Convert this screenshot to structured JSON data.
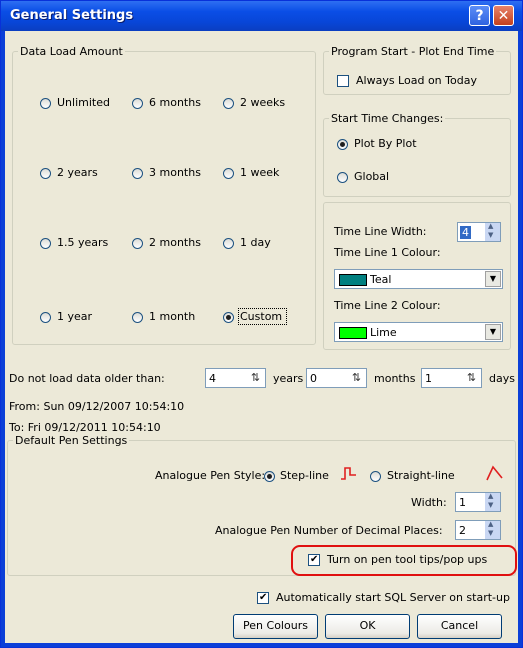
{
  "window": {
    "title": "General Settings",
    "help_glyph": "?",
    "close_glyph": "✕"
  },
  "data_load": {
    "legend": "Data Load Amount",
    "options": [
      "Unlimited",
      "6 months",
      "2 weeks",
      "2 years",
      "3 months",
      "1 week",
      "1.5 years",
      "2 months",
      "1 day",
      "1 year",
      "1 month",
      "Custom"
    ],
    "selected": "Custom"
  },
  "program_start": {
    "legend": "Program Start - Plot End Time",
    "always_load_label": "Always Load on Today",
    "always_load_checked": false
  },
  "start_time": {
    "legend": "Start Time Changes:",
    "plot_by_plot": "Plot By Plot",
    "global": "Global",
    "selected": "Plot By Plot"
  },
  "timeline": {
    "width_label": "Time Line Width:",
    "width_value": "4",
    "colour1_label": "Time Line 1 Colour:",
    "colour1_value": "Teal",
    "colour1_hex": "#008080",
    "colour2_label": "Time Line 2 Colour:",
    "colour2_value": "Lime",
    "colour2_hex": "#00ff00"
  },
  "older": {
    "label": "Do not load data older than:",
    "years_value": "4",
    "years_label": "years",
    "months_value": "0",
    "months_label": "months",
    "days_value": "1",
    "days_label": "days"
  },
  "range": {
    "from": "From:  Sun 09/12/2007 10:54:10",
    "to": "To:  Fri 09/12/2011 10:54:10"
  },
  "pen": {
    "legend": "Default Pen Settings",
    "style_label": "Analogue Pen Style:",
    "step_label": "Step-line",
    "straight_label": "Straight-line",
    "selected": "Step-line",
    "width_label": "Width:",
    "width_value": "1",
    "decimals_label": "Analogue Pen Number of Decimal Places:",
    "decimals_value": "2",
    "tooltips_label": "Turn on pen tool tips/pop ups",
    "tooltips_checked": true
  },
  "sql_label": "Automatically start SQL Server on start-up",
  "sql_checked": true,
  "buttons": {
    "pen_colours": "Pen Colours",
    "ok": "OK",
    "cancel": "Cancel"
  },
  "colors": {
    "highlight": "#e01010",
    "title_bar": "#0a4ee6",
    "pen_icon": "#e02020"
  }
}
